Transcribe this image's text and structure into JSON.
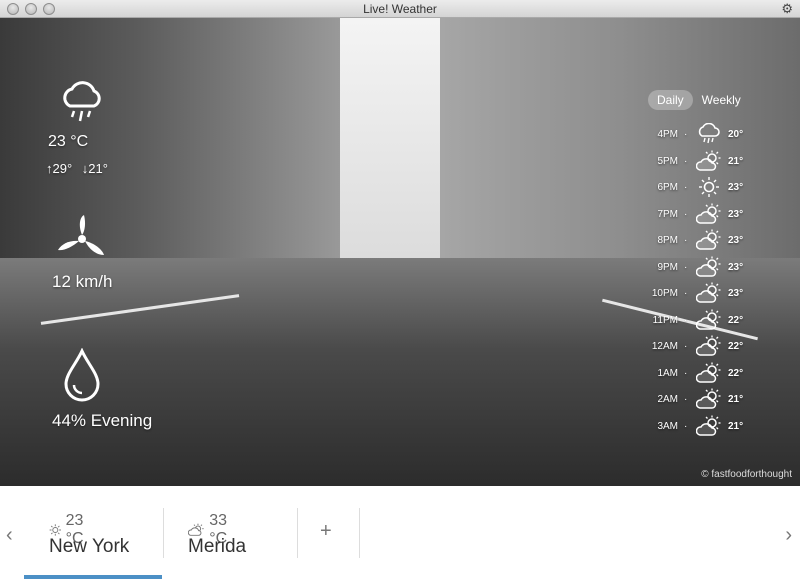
{
  "window": {
    "title": "Live! Weather"
  },
  "current": {
    "temperature": "23 °C",
    "high": "29°",
    "low": "21°",
    "wind": "12 km/h",
    "humidity": "44% Evening",
    "condition_icon": "cloud-rain-icon"
  },
  "toggle": {
    "daily": "Daily",
    "weekly": "Weekly",
    "selected": "Daily"
  },
  "hourly": [
    {
      "time": "4PM",
      "temp": "20°",
      "icon": "cloud-rain-icon"
    },
    {
      "time": "5PM",
      "temp": "21°",
      "icon": "partly-cloudy-icon"
    },
    {
      "time": "6PM",
      "temp": "23°",
      "icon": "sun-icon"
    },
    {
      "time": "7PM",
      "temp": "23°",
      "icon": "partly-cloudy-icon"
    },
    {
      "time": "8PM",
      "temp": "23°",
      "icon": "partly-cloudy-icon"
    },
    {
      "time": "9PM",
      "temp": "23°",
      "icon": "partly-cloudy-icon"
    },
    {
      "time": "10PM",
      "temp": "23°",
      "icon": "partly-cloudy-icon"
    },
    {
      "time": "11PM",
      "temp": "22°",
      "icon": "partly-cloudy-icon"
    },
    {
      "time": "12AM",
      "temp": "22°",
      "icon": "partly-cloudy-icon"
    },
    {
      "time": "1AM",
      "temp": "22°",
      "icon": "partly-cloudy-icon"
    },
    {
      "time": "2AM",
      "temp": "21°",
      "icon": "partly-cloudy-icon"
    },
    {
      "time": "3AM",
      "temp": "21°",
      "icon": "partly-cloudy-icon"
    }
  ],
  "photo_credit": "© fastfoodforthought",
  "cities": [
    {
      "name": "New York",
      "temp": "23 °C",
      "icon": "sun-icon",
      "active": true
    },
    {
      "name": "Merida",
      "temp": "33 °C",
      "icon": "partly-cloudy-icon",
      "active": false
    }
  ],
  "add_city_label": "+",
  "colors": {
    "accent": "#4c90c6"
  }
}
